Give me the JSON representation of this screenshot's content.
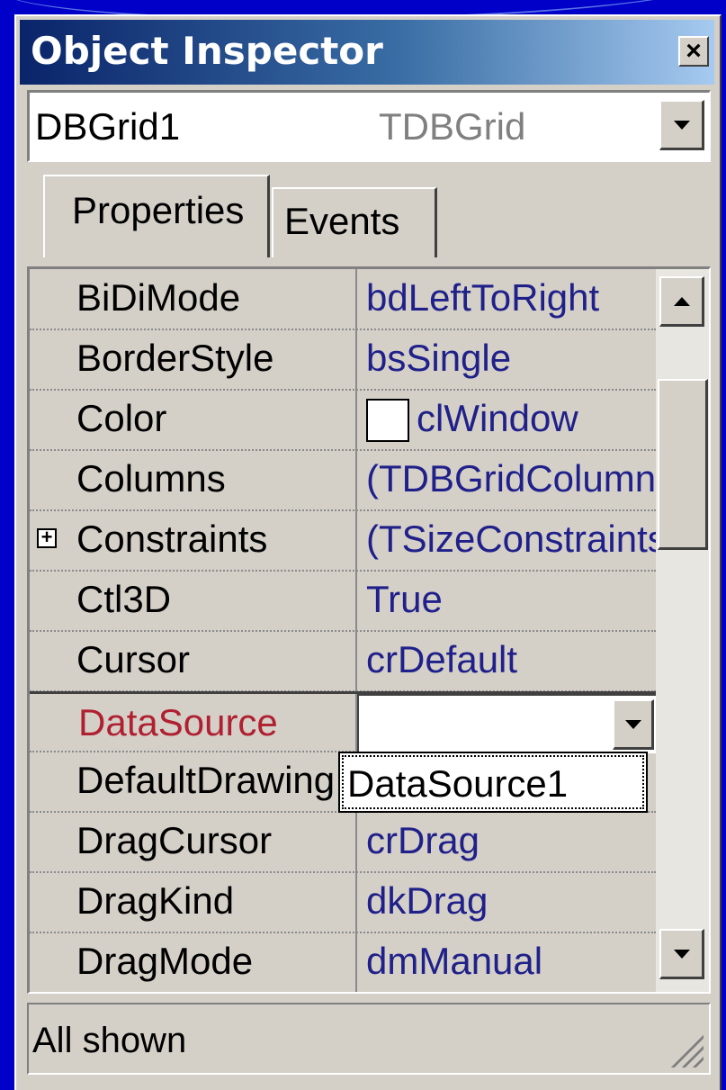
{
  "window": {
    "title": "Object Inspector",
    "close_symbol": "×"
  },
  "object_selector": {
    "name": "DBGrid1",
    "type": "TDBGrid"
  },
  "tabs": [
    {
      "label": "Properties"
    },
    {
      "label": "Events"
    }
  ],
  "properties": [
    {
      "name": "BiDiMode",
      "value": "bdLeftToRight"
    },
    {
      "name": "BorderStyle",
      "value": "bsSingle"
    },
    {
      "name": "Color",
      "value": "clWindow"
    },
    {
      "name": "Columns",
      "value": "(TDBGridColumns)"
    },
    {
      "name": "Constraints",
      "value": "(TSizeConstraints)"
    },
    {
      "name": "Ctl3D",
      "value": "True"
    },
    {
      "name": "Cursor",
      "value": "crDefault"
    },
    {
      "name": "DataSource",
      "value": ""
    },
    {
      "name": "DefaultDrawing",
      "value": ""
    },
    {
      "name": "DragCursor",
      "value": "crDrag"
    },
    {
      "name": "DragKind",
      "value": "dkDrag"
    },
    {
      "name": "DragMode",
      "value": "dmManual"
    }
  ],
  "dropdown": {
    "options": [
      "DataSource1"
    ]
  },
  "status": {
    "text": "All shown"
  },
  "icons": {
    "close": "close-icon",
    "combo_arrow": "chevron-down-icon",
    "expand": "plus-icon",
    "scroll_up": "arrow-up-icon",
    "scroll_down": "arrow-down-icon",
    "resize": "resize-grip-icon"
  },
  "colors": {
    "title_start": "#0a246a",
    "title_end": "#a6caf0",
    "value_text": "#20208a",
    "selected_name": "#b02030",
    "face": "#d4d0c8",
    "background": "#0000c8"
  }
}
